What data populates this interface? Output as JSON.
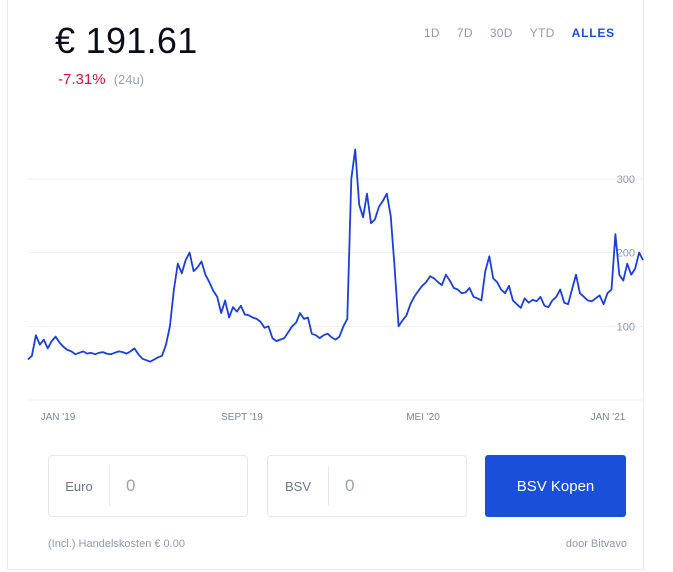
{
  "price": "€ 191.61",
  "change": "-7.31%",
  "change_period": "(24u)",
  "ranges": [
    {
      "label": "1D",
      "active": false
    },
    {
      "label": "7D",
      "active": false
    },
    {
      "label": "30D",
      "active": false
    },
    {
      "label": "YTD",
      "active": false
    },
    {
      "label": "ALLES",
      "active": true
    }
  ],
  "colors": {
    "line": "#1a3fdc",
    "negative": "#d0153a",
    "accent": "#1a50d9"
  },
  "chart_data": {
    "type": "line",
    "x_tick_labels": [
      "JAN '19",
      "SEPT '19",
      "MEI '20",
      "JAN '21"
    ],
    "y_tick_values": [
      100,
      200,
      300
    ],
    "ylim": [
      0,
      380
    ],
    "grid": true,
    "series": [
      {
        "values": [
          55,
          60,
          88,
          75,
          82,
          70,
          80,
          86,
          78,
          72,
          68,
          66,
          62,
          64,
          66,
          63,
          64,
          62,
          64,
          65,
          63,
          62,
          64,
          66,
          65,
          63,
          66,
          70,
          62,
          56,
          54,
          52,
          55,
          58,
          60,
          75,
          100,
          150,
          185,
          172,
          190,
          200,
          175,
          180,
          188,
          170,
          160,
          148,
          140,
          118,
          135,
          112,
          126,
          120,
          128,
          116,
          115,
          112,
          110,
          106,
          98,
          100,
          84,
          80,
          82,
          84,
          92,
          100,
          105,
          118,
          110,
          112,
          90,
          88,
          84,
          88,
          90,
          85,
          82,
          86,
          100,
          110,
          300,
          340,
          265,
          248,
          280,
          240,
          245,
          262,
          270,
          280,
          250,
          180,
          100,
          108,
          115,
          130,
          140,
          148,
          155,
          160,
          168,
          165,
          160,
          156,
          170,
          162,
          152,
          150,
          145,
          146,
          152,
          140,
          138,
          135,
          175,
          195,
          165,
          160,
          150,
          145,
          155,
          135,
          130,
          125,
          138,
          132,
          136,
          134,
          140,
          128,
          126,
          135,
          140,
          150,
          132,
          130,
          150,
          170,
          145,
          140,
          135,
          134,
          138,
          142,
          130,
          145,
          150,
          225,
          170,
          162,
          185,
          170,
          178,
          200,
          190
        ]
      }
    ]
  },
  "form": {
    "euro_label": "Euro",
    "euro_value": "0",
    "bsv_label": "BSV",
    "bsv_value": "0",
    "buy_label": "BSV Kopen"
  },
  "footer": {
    "fees": "(Incl.) Handelskosten € 0.00",
    "provider": "door Bitvavo"
  }
}
